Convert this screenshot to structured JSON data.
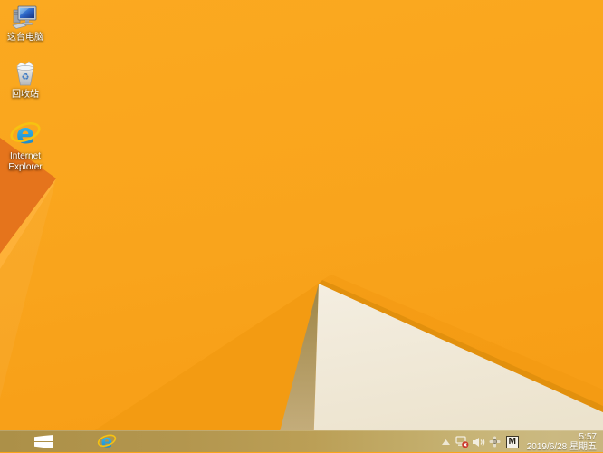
{
  "desktop": {
    "icons": [
      {
        "name": "this-pc",
        "label": "这台电脑"
      },
      {
        "name": "recycle-bin",
        "label": "回收站"
      },
      {
        "name": "internet-explorer",
        "label": "Internet Explorer"
      }
    ]
  },
  "taskbar": {
    "pinned": [
      {
        "name": "internet-explorer"
      }
    ],
    "tray": {
      "icons": [
        {
          "name": "show-hidden-icons"
        },
        {
          "name": "network-disconnected"
        },
        {
          "name": "volume"
        },
        {
          "name": "hardware-utility"
        },
        {
          "name": "ime",
          "label": "M"
        }
      ]
    },
    "clock": {
      "time": "5:57",
      "date": "2019/6/28 星期五"
    }
  },
  "colors": {
    "wallpaper_orange": "#F9A41C",
    "wallpaper_dark_orange": "#E5741C",
    "wallpaper_facet_shade": "#F39B12",
    "wallpaper_cream": "#F1EAD9",
    "wallpaper_shadow_olive": "#AE9458",
    "taskbar_tan": "#B5994F",
    "ie_blue": "#1E9CD7",
    "ie_gold": "#F6C211",
    "error_red": "#CC3A2E",
    "text_white": "#FFFFFF"
  }
}
